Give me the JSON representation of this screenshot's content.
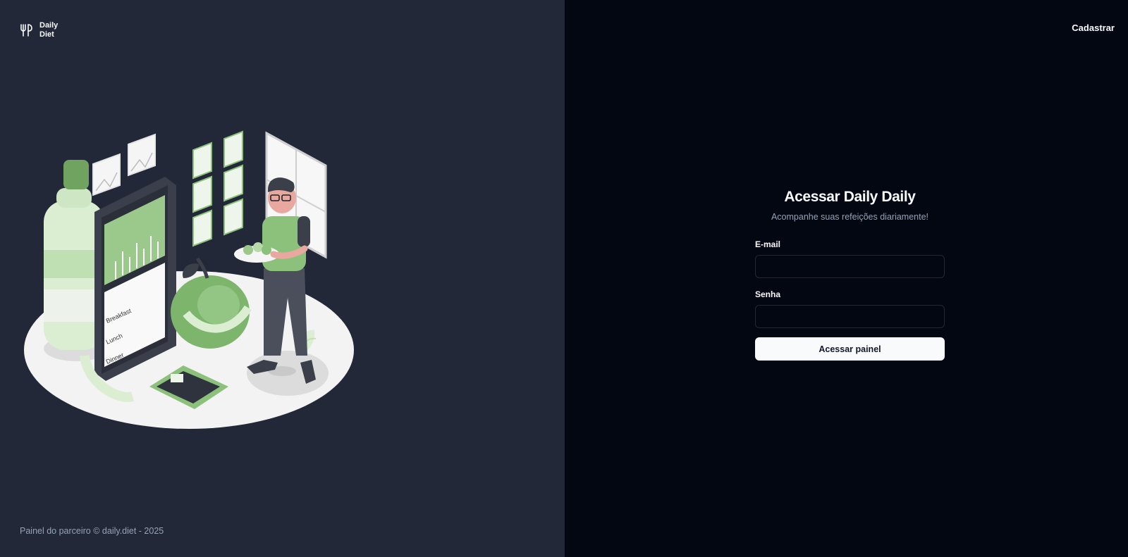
{
  "brand": {
    "name": "Daily\nDiet",
    "icon": "fork-knife-icon"
  },
  "header": {
    "signup_label": "Cadastrar"
  },
  "login": {
    "title": "Acessar Daily Daily",
    "subtitle": "Acompanhe suas refeições diariamente!",
    "email_label": "E-mail",
    "email_value": "",
    "password_label": "Senha",
    "password_value": "",
    "submit_label": "Acessar painel"
  },
  "footer": {
    "copyright": "Painel do parceiro © daily.diet - 2025"
  },
  "illustration": {
    "phone_labels": [
      "Breakfast",
      "Lunch",
      "Dinner"
    ]
  },
  "colors": {
    "left_panel_bg": "#232838",
    "right_panel_bg": "#030712",
    "accent_green": "#8bc17b",
    "button_bg": "#f8fafc"
  }
}
